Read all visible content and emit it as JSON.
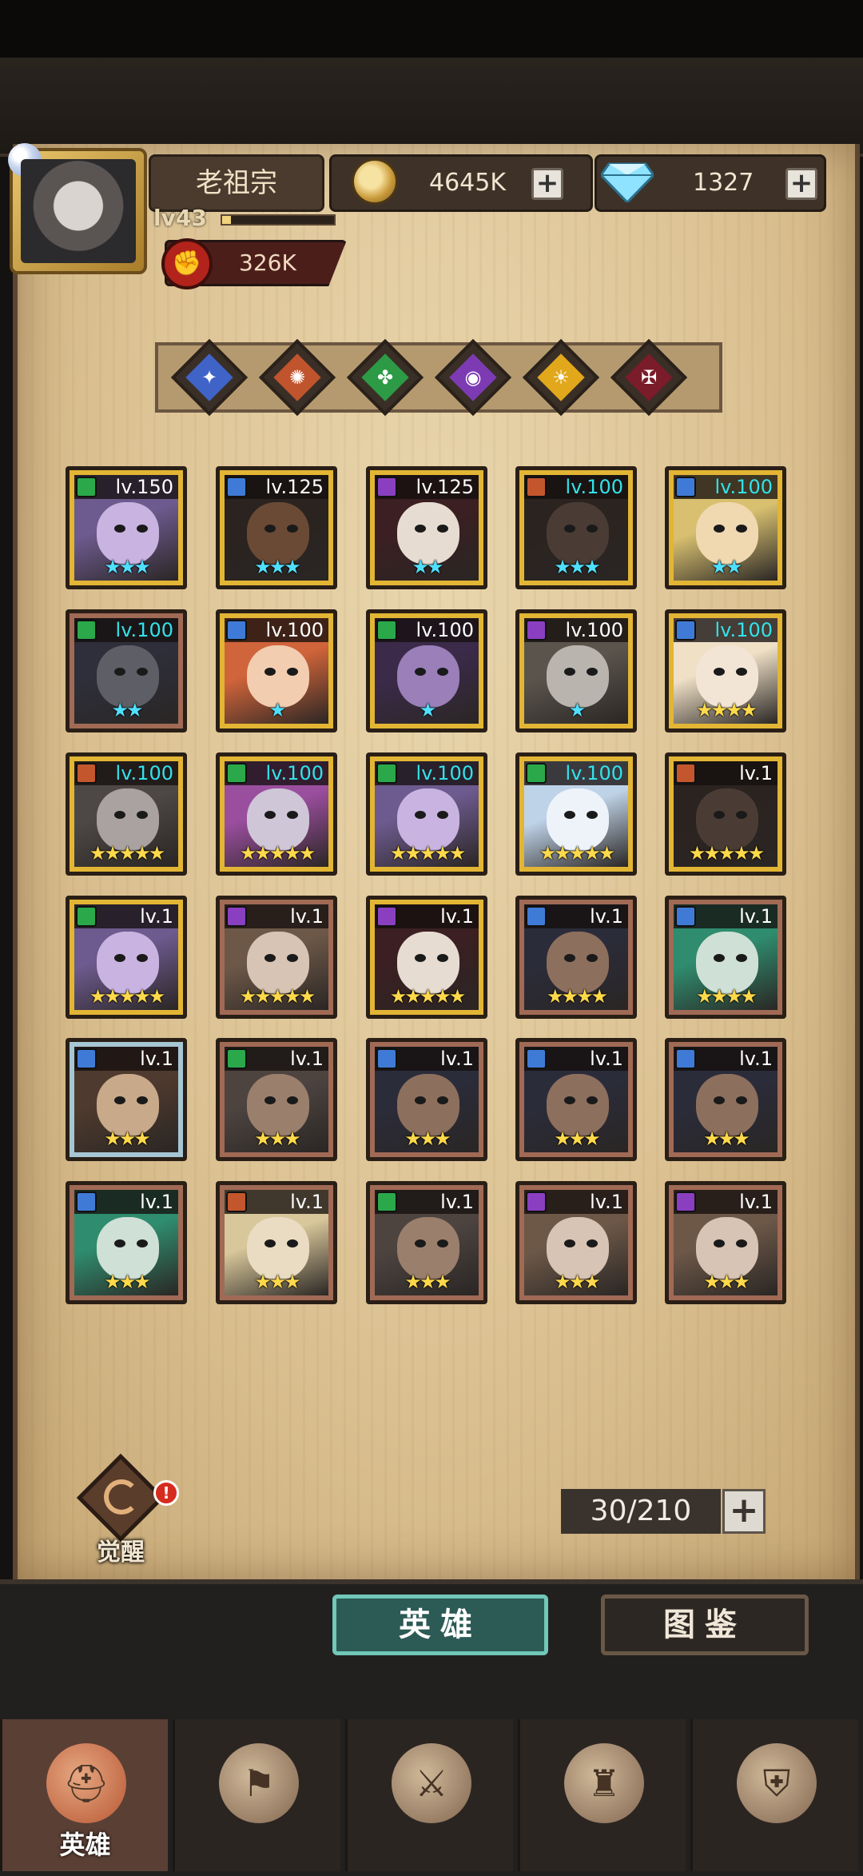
{
  "player": {
    "name": "老祖宗",
    "level": "lv43",
    "xp_fraction": 0.08,
    "power": "326K"
  },
  "resources": {
    "gold": "4645K",
    "gems": "1327"
  },
  "factions": [
    {
      "icon": "wing-staff-icon",
      "color": "#3f63c7"
    },
    {
      "icon": "flame-sigil-icon",
      "color": "#c0542d"
    },
    {
      "icon": "clover-icon",
      "color": "#2d9a45"
    },
    {
      "icon": "moon-eye-icon",
      "color": "#7d3bb3"
    },
    {
      "icon": "sun-eye-icon",
      "color": "#e2a81b"
    },
    {
      "icon": "demon-sigil-icon",
      "color": "#7a1c2a"
    }
  ],
  "heroes": [
    {
      "level": "lv.150",
      "frame": "gold",
      "stars": 3,
      "star_color": "cyan",
      "level_color": "white",
      "class_color": "#2aa84a",
      "skin": "#c9b3e0",
      "hair": "#6d5a8e"
    },
    {
      "level": "lv.125",
      "frame": "gold",
      "stars": 3,
      "star_color": "cyan",
      "level_color": "white",
      "class_color": "#3f7bd6",
      "skin": "#6b4a35",
      "hair": "#2a2320"
    },
    {
      "level": "lv.125",
      "frame": "gold",
      "stars": 2,
      "star_color": "cyan",
      "level_color": "white",
      "class_color": "#8a3fc0",
      "skin": "#e7dcd2",
      "hair": "#3b1f22"
    },
    {
      "level": "lv.100",
      "frame": "gold",
      "stars": 3,
      "star_color": "cyan",
      "level_color": "cyan",
      "class_color": "#c4562d",
      "skin": "#4a3c34",
      "hair": "#2b2320"
    },
    {
      "level": "lv.100",
      "frame": "gold",
      "stars": 2,
      "star_color": "cyan",
      "level_color": "cyan",
      "class_color": "#3f7bd6",
      "skin": "#f0d8b0",
      "hair": "#d8c070"
    },
    {
      "level": "lv.100",
      "frame": "bronze",
      "stars": 2,
      "star_color": "cyan",
      "level_color": "cyan",
      "class_color": "#2aa84a",
      "skin": "#5e5f66",
      "hair": "#2e2f3a"
    },
    {
      "level": "lv.100",
      "frame": "gold",
      "stars": 1,
      "star_color": "cyan",
      "level_color": "white",
      "class_color": "#3f7bd6",
      "skin": "#f2cdb0",
      "hair": "#d0643a"
    },
    {
      "level": "lv.100",
      "frame": "gold",
      "stars": 1,
      "star_color": "cyan",
      "level_color": "white",
      "class_color": "#2aa84a",
      "skin": "#9a7fb8",
      "hair": "#3b2a4a"
    },
    {
      "level": "lv.100",
      "frame": "gold",
      "stars": 1,
      "star_color": "cyan",
      "level_color": "white",
      "class_color": "#8a3fc0",
      "skin": "#b9b4ae",
      "hair": "#5a544c"
    },
    {
      "level": "lv.100",
      "frame": "gold",
      "stars": 4,
      "star_color": "gold",
      "level_color": "cyan",
      "class_color": "#3f7bd6",
      "skin": "#f3e5d6",
      "hair": "#efe0c6"
    },
    {
      "level": "lv.100",
      "frame": "gold",
      "stars": 5,
      "star_color": "gold",
      "level_color": "cyan",
      "class_color": "#c4562d",
      "skin": "#a9a2a0",
      "hair": "#4d4745"
    },
    {
      "level": "lv.100",
      "frame": "gold",
      "stars": 5,
      "star_color": "gold",
      "level_color": "cyan",
      "class_color": "#2aa84a",
      "skin": "#cfc6d8",
      "hair": "#9a4e9e"
    },
    {
      "level": "lv.100",
      "frame": "gold",
      "stars": 5,
      "star_color": "gold",
      "level_color": "cyan",
      "class_color": "#2aa84a",
      "skin": "#c9b3e0",
      "hair": "#6d5a8e"
    },
    {
      "level": "lv.100",
      "frame": "gold",
      "stars": 5,
      "star_color": "gold",
      "level_color": "cyan",
      "class_color": "#2aa84a",
      "skin": "#eef3fa",
      "hair": "#bfd3e8"
    },
    {
      "level": "lv.1",
      "frame": "gold",
      "stars": 5,
      "star_color": "gold",
      "level_color": "white",
      "class_color": "#c4562d",
      "skin": "#4a3c34",
      "hair": "#2b2320"
    },
    {
      "level": "lv.1",
      "frame": "gold",
      "stars": 5,
      "star_color": "gold",
      "level_color": "white",
      "class_color": "#2aa84a",
      "skin": "#c9b3e0",
      "hair": "#6d5a8e"
    },
    {
      "level": "lv.1",
      "frame": "bronze",
      "stars": 5,
      "star_color": "gold",
      "level_color": "white",
      "class_color": "#8a3fc0",
      "skin": "#d7c4b4",
      "hair": "#6d5848"
    },
    {
      "level": "lv.1",
      "frame": "gold",
      "stars": 5,
      "star_color": "gold",
      "level_color": "white",
      "class_color": "#8a3fc0",
      "skin": "#e7dcd2",
      "hair": "#3b1f22"
    },
    {
      "level": "lv.1",
      "frame": "bronze",
      "stars": 4,
      "star_color": "gold",
      "level_color": "white",
      "class_color": "#3f7bd6",
      "skin": "#8d6f5e",
      "hair": "#2b2c3a"
    },
    {
      "level": "lv.1",
      "frame": "bronze",
      "stars": 4,
      "star_color": "gold",
      "level_color": "white",
      "class_color": "#3f7bd6",
      "skin": "#cfe0d6",
      "hair": "#2f8c6e"
    },
    {
      "level": "lv.1",
      "frame": "silver",
      "stars": 3,
      "star_color": "gold",
      "level_color": "white",
      "class_color": "#3f7bd6",
      "skin": "#c8a98a",
      "hair": "#4e3a2e"
    },
    {
      "level": "lv.1",
      "frame": "bronze",
      "stars": 3,
      "star_color": "gold",
      "level_color": "white",
      "class_color": "#2aa84a",
      "skin": "#9b7f6d",
      "hair": "#4d4440"
    },
    {
      "level": "lv.1",
      "frame": "bronze",
      "stars": 3,
      "star_color": "gold",
      "level_color": "white",
      "class_color": "#3f7bd6",
      "skin": "#8d6f5e",
      "hair": "#2b2c3a"
    },
    {
      "level": "lv.1",
      "frame": "bronze",
      "stars": 3,
      "star_color": "gold",
      "level_color": "white",
      "class_color": "#3f7bd6",
      "skin": "#8d6f5e",
      "hair": "#2b2c3a"
    },
    {
      "level": "lv.1",
      "frame": "bronze",
      "stars": 3,
      "star_color": "gold",
      "level_color": "white",
      "class_color": "#3f7bd6",
      "skin": "#8d6f5e",
      "hair": "#2b2c3a"
    },
    {
      "level": "lv.1",
      "frame": "bronze",
      "stars": 3,
      "star_color": "gold",
      "level_color": "white",
      "class_color": "#3f7bd6",
      "skin": "#cfe0d6",
      "hair": "#2f8c6e"
    },
    {
      "level": "lv.1",
      "frame": "bronze",
      "stars": 3,
      "star_color": "gold",
      "level_color": "white",
      "class_color": "#c4562d",
      "skin": "#e9dcc2",
      "hair": "#d8c79a"
    },
    {
      "level": "lv.1",
      "frame": "bronze",
      "stars": 3,
      "star_color": "gold",
      "level_color": "white",
      "class_color": "#2aa84a",
      "skin": "#9b7f6d",
      "hair": "#4d4440"
    },
    {
      "level": "lv.1",
      "frame": "bronze",
      "stars": 3,
      "star_color": "gold",
      "level_color": "white",
      "class_color": "#8a3fc0",
      "skin": "#d7c4b4",
      "hair": "#6d5848"
    },
    {
      "level": "lv.1",
      "frame": "bronze",
      "stars": 3,
      "star_color": "gold",
      "level_color": "white",
      "class_color": "#8a3fc0",
      "skin": "#d7c4b4",
      "hair": "#6d5848"
    }
  ],
  "awaken": {
    "label": "觉醒",
    "alert": "!"
  },
  "capacity": "30/210",
  "subtabs": {
    "heroes": "英雄",
    "codex": "图鉴"
  },
  "nav": [
    {
      "label": "英雄",
      "icon": "helmet-icon",
      "active": true
    },
    {
      "label": "",
      "icon": "flag-wheel-icon",
      "active": false
    },
    {
      "label": "",
      "icon": "crossed-swords-icon",
      "active": false
    },
    {
      "label": "",
      "icon": "castle-icon",
      "active": false
    },
    {
      "label": "",
      "icon": "handshake-shield-icon",
      "active": false
    }
  ]
}
